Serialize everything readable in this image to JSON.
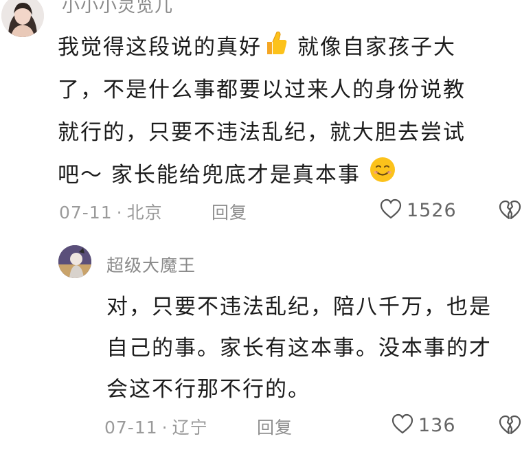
{
  "comments": [
    {
      "username": "小小小灵览儿",
      "lines": [
        "我觉得这段说的真好",
        "了，不是什么事都要以过来人的身份说教",
        "就行的，只要不违法乱纪，就大胆去尝试",
        "吧～ 家长能给兜底才是真本事"
      ],
      "line1_suffix": "就像自家孩子大",
      "date": "07-11",
      "location": "北京",
      "reply_label": "回复",
      "likes": "1526"
    },
    {
      "username": "超级大魔王",
      "lines": [
        "对，只要不违法乱纪，陪八千万，也是",
        "自己的事。家长有这本事。没本事的才",
        "会这不行那不行的。"
      ],
      "date": "07-11",
      "location": "辽宁",
      "reply_label": "回复",
      "likes": "136"
    }
  ],
  "icons": {
    "like": "heart-outline-icon",
    "dislike": "broken-heart-icon",
    "thumbs_up": "thumbs-up-emoji",
    "smile": "smile-emoji"
  },
  "colors": {
    "text": "#1c1c1c",
    "meta": "#9a9a9a",
    "background": "#ffffff"
  }
}
